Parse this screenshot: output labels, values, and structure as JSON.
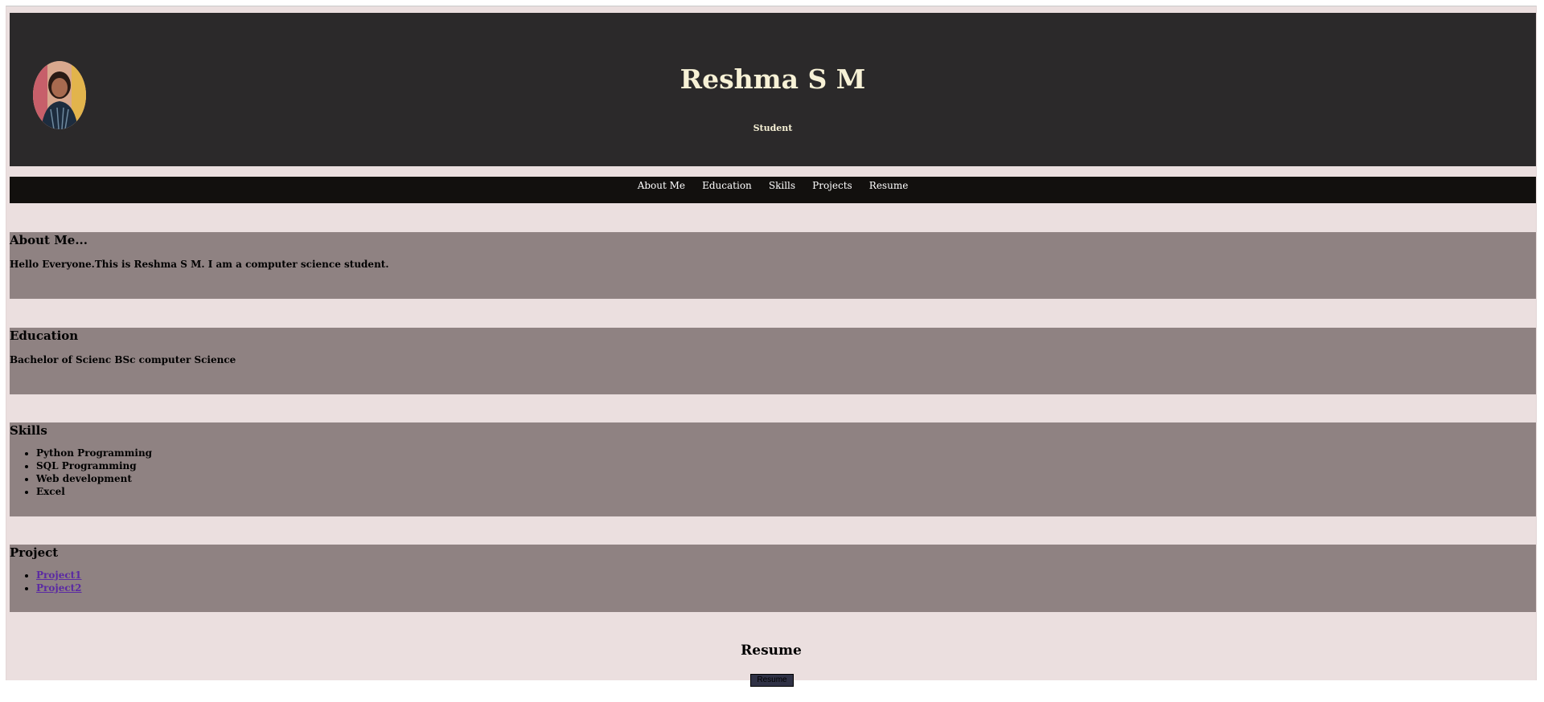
{
  "header": {
    "name": "Reshma S M",
    "subtitle": "Student",
    "avatar_icon": "profile-photo"
  },
  "nav": {
    "items": [
      {
        "label": "About Me"
      },
      {
        "label": "Education"
      },
      {
        "label": "Skills"
      },
      {
        "label": "Projects"
      },
      {
        "label": "Resume"
      }
    ]
  },
  "about": {
    "heading": "About Me...",
    "text": "Hello Everyone.This is Reshma S M. I am a computer science student."
  },
  "education": {
    "heading": "Education",
    "text": "Bachelor of Scienc BSc computer Science"
  },
  "skills": {
    "heading": "Skills",
    "items": [
      "Python Programming",
      "SQL Programming",
      "Web development",
      "Excel"
    ]
  },
  "project": {
    "heading": "Project",
    "links": [
      "Project1",
      "Project2"
    ]
  },
  "resume": {
    "heading": "Resume",
    "button_label": "Resume"
  },
  "colors": {
    "page_background": "#ebdfdf",
    "header_background": "#2b292a",
    "nav_background": "#12100e",
    "section_background": "#8f8282",
    "title_color": "#f7f1d6",
    "link_color": "#5b2aa3"
  }
}
